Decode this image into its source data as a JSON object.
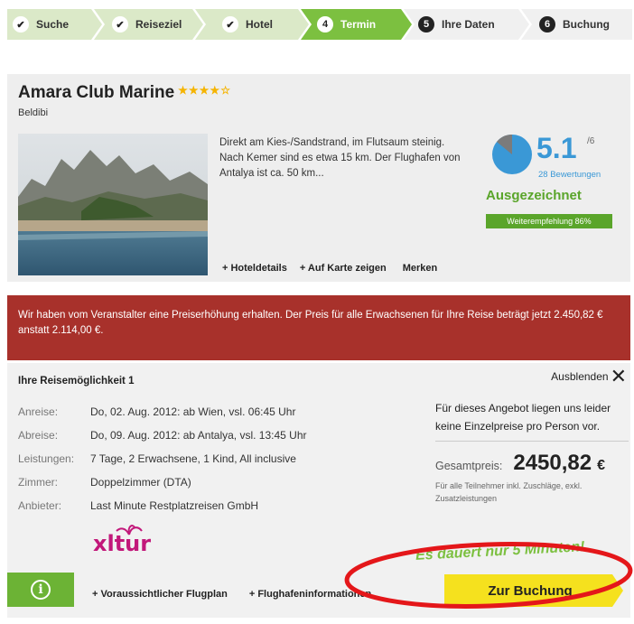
{
  "steps": [
    {
      "label": "Suche",
      "state": "done",
      "marker": "✔"
    },
    {
      "label": "Reiseziel",
      "state": "done",
      "marker": "✔"
    },
    {
      "label": "Hotel",
      "state": "done",
      "marker": "✔"
    },
    {
      "label": "Termin",
      "state": "active",
      "marker": "4"
    },
    {
      "label": "Ihre Daten",
      "state": "todo",
      "marker": "5"
    },
    {
      "label": "Buchung",
      "state": "todo",
      "marker": "6"
    }
  ],
  "hotel": {
    "name": "Amara Club Marine",
    "stars": "★★★★☆",
    "star_rating": 4.5,
    "location": "Beldibi",
    "description": "Direkt am Kies-/Sandstrand, im Flutsaum steinig. Nach Kemer sind es etwa 15 km. Der Flughafen von Antalya ist ca. 50 km...",
    "links": {
      "details": "+ Hoteldetails",
      "map": "+ Auf Karte zeigen",
      "remember": "Merken"
    },
    "rating": {
      "score": "5.1",
      "max": "/6",
      "reviews": "28 Bewertungen",
      "verdict": "Ausgezeichnet",
      "recommendation": "Weiterempfehlung 86%"
    }
  },
  "alert": {
    "text": "Wir haben vom Veranstalter eine Preiserhöhung erhalten. Der Preis für alle Erwachsenen für Ihre Reise beträgt jetzt 2.450,82 € anstatt 2.114,00 €."
  },
  "option": {
    "title": "Ihre Reisemöglichkeit 1",
    "hide_label": "Ausblenden",
    "details": [
      {
        "label": "Anreise:",
        "value": "Do, 02. Aug. 2012: ab Wien, vsl. 06:45 Uhr"
      },
      {
        "label": "Abreise:",
        "value": "Do, 09. Aug. 2012: ab Antalya, vsl. 13:45 Uhr"
      },
      {
        "label": "Leistungen:",
        "value": "7 Tage, 2 Erwachsene, 1 Kind, All inclusive"
      },
      {
        "label": "Zimmer:",
        "value": "Doppelzimmer (DTA)"
      },
      {
        "label": "Anbieter:",
        "value": "Last Minute Restplatzreisen GmbH"
      }
    ],
    "provider_logo": "xltur",
    "no_single_price": "Für dieses Angebot liegen uns leider keine Einzelpreise pro Person vor.",
    "total_label": "Gesamtpreis:",
    "total_value": "2450,82",
    "currency": "€",
    "total_note": "Für alle Teilnehmer inkl. Zuschläge, exkl. Zusatzleistungen",
    "hurry_text": "Es dauert nur 5 Minuten!",
    "flight_plan": "+ Voraussichtlicher Flugplan",
    "airport_info": "+ Flughafeninformationen",
    "book_label": "Zur Buchung"
  },
  "colors": {
    "green": "#6cb335",
    "alert_red": "#a8312b",
    "book_yellow": "#f5e11e",
    "rating_blue": "#3a98d6"
  }
}
